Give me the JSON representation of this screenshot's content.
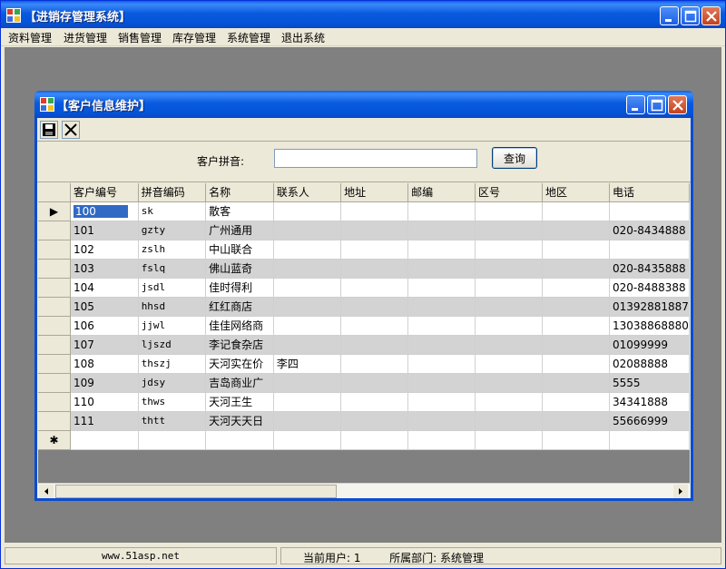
{
  "app": {
    "title": "【进销存管理系统】"
  },
  "menu": [
    "资料管理",
    "进货管理",
    "销售管理",
    "库存管理",
    "系统管理",
    "退出系统"
  ],
  "child": {
    "title": "【客户信息维护】"
  },
  "toolbar": {
    "save_icon": "save-icon",
    "close_icon": "close-icon"
  },
  "search": {
    "label": "客户拼音:",
    "value": "",
    "button": "查询"
  },
  "grid": {
    "columns": [
      "客户编号",
      "拼音编码",
      "名称",
      "联系人",
      "地址",
      "邮编",
      "区号",
      "地区",
      "电话"
    ],
    "rows": [
      [
        "100",
        "sk",
        "散客",
        "",
        "",
        "",
        "",
        "",
        ""
      ],
      [
        "101",
        "gzty",
        "广州通用",
        "",
        "",
        "",
        "",
        "",
        "020-8434888"
      ],
      [
        "102",
        "zslh",
        "中山联合",
        "",
        "",
        "",
        "",
        "",
        ""
      ],
      [
        "103",
        "fslq",
        "佛山蓝奇",
        "",
        "",
        "",
        "",
        "",
        "020-8435888"
      ],
      [
        "104",
        "jsdl",
        "佳时得利",
        "",
        "",
        "",
        "",
        "",
        "020-8488388"
      ],
      [
        "105",
        "hhsd",
        "红红商店",
        "",
        "",
        "",
        "",
        "",
        "01392881887"
      ],
      [
        "106",
        "jjwl",
        "佳佳网络商",
        "",
        "",
        "",
        "",
        "",
        "13038868880"
      ],
      [
        "107",
        "ljszd",
        "李记食杂店",
        "",
        "",
        "",
        "",
        "",
        "01099999"
      ],
      [
        "108",
        "thszj",
        "天河实在价",
        "李四",
        "",
        "",
        "",
        "",
        "02088888"
      ],
      [
        "109",
        "jdsy",
        "吉岛商业广",
        "",
        "",
        "",
        "",
        "",
        "5555"
      ],
      [
        "110",
        "thws",
        "天河王生",
        "",
        "",
        "",
        "",
        "",
        "34341888"
      ],
      [
        "111",
        "thtt",
        "天河天天日",
        "",
        "",
        "",
        "",
        "",
        "55666999"
      ]
    ],
    "current_row_marker": "▶",
    "new_row_marker": "✱"
  },
  "status": {
    "site": "www.51asp.net",
    "user": "当前用户: 1",
    "dept": "所属部门: 系统管理"
  }
}
